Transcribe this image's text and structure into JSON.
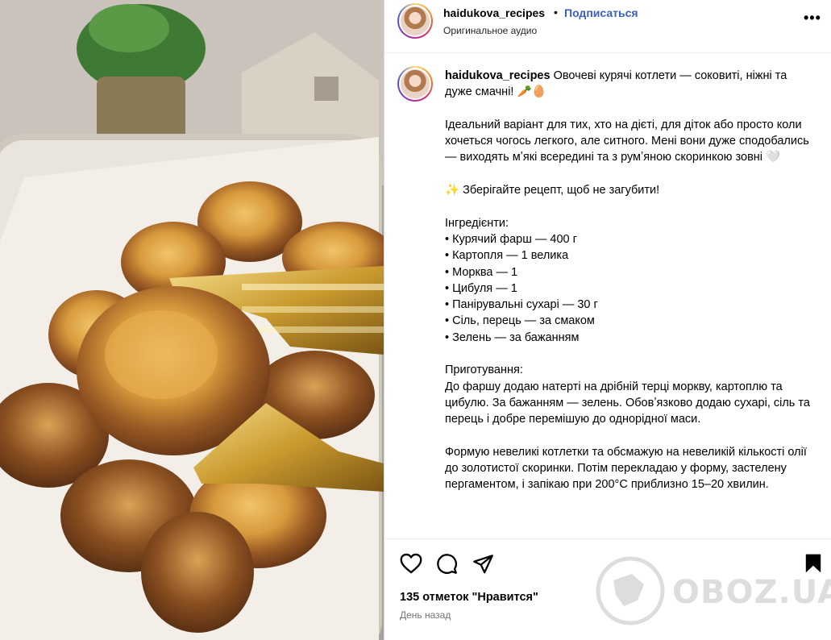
{
  "post": {
    "username": "haidukova_recipes",
    "separator": "•",
    "follow_label": "Подписаться",
    "audio_label": "Оригинальное аудио",
    "more_label": "•••"
  },
  "caption": {
    "username": "haidukova_recipes",
    "lines": [
      "Овочеві курячі котлети — соковиті, ніжні та дуже смачні! 🥕🥚",
      "",
      "Ідеальний варіант для тих, хто на дієті, для діток або просто коли хочеться чогось легкого, але ситного. Мені вони дуже сподобались — виходять мʼякі всередині та з румʼяною скоринкою зовні 🤍",
      "",
      "✨ Зберігайте рецепт, щоб не загубити!",
      "",
      "Інгредієнти:",
      "• Курячий фарш — 400 г",
      "• Картопля — 1 велика",
      "• Морква — 1",
      "• Цибуля — 1",
      "• Панірувальні сухарі — 30 г",
      "• Сіль, перець — за смаком",
      "• Зелень — за бажанням",
      "",
      "Приготування:",
      "До фаршу додаю натерті на дрібній терці моркву, картоплю та цибулю. За бажанням — зелень. Обовʼязково додаю сухарі, сіль та перець і добре перемішую до однорідної маси.",
      "",
      "Формую невеликі котлетки та обсмажую на невеликій кількості олії до золотистої скоринки. Потім перекладаю у форму, застелену пергаментом, і запікаю при 200°С приблизно 15–20 хвилин."
    ]
  },
  "actions": {
    "like_icon": "heart-icon",
    "comment_icon": "comment-icon",
    "share_icon": "paper-plane-icon",
    "save_icon": "bookmark-icon"
  },
  "likes_text": "135 отметок \"Нравится\"",
  "time_text": "День назад",
  "watermark_text": "OBOZ.UA"
}
